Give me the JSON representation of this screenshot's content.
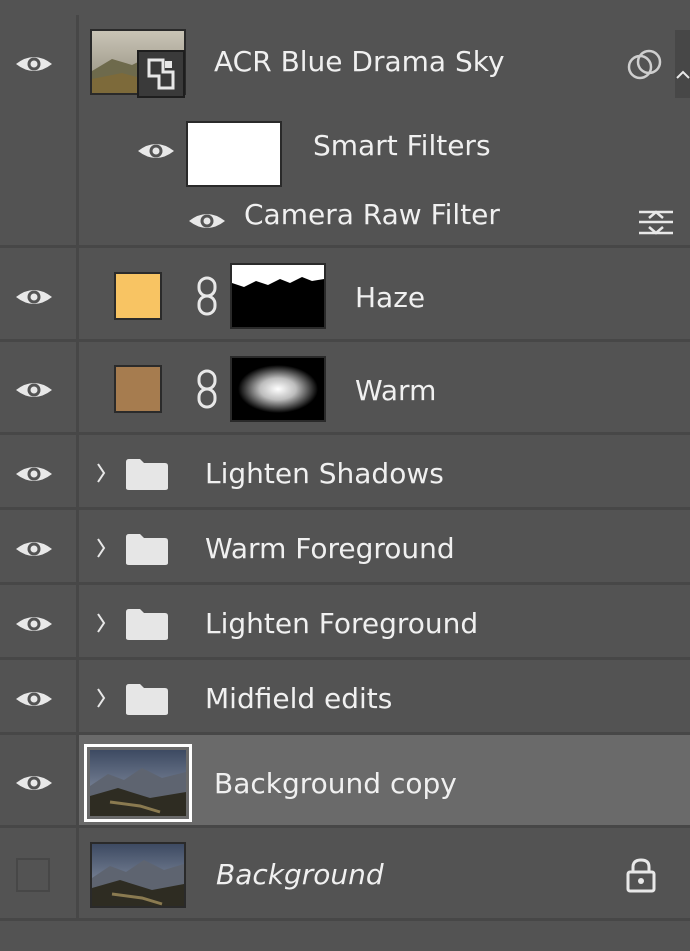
{
  "layers": {
    "acr": {
      "name": "ACR Blue Drama Sky"
    },
    "smart_filters": {
      "name": "Smart Filters"
    },
    "camera_raw": {
      "name": "Camera Raw Filter"
    },
    "haze": {
      "name": "Haze",
      "fill_color": "#f8c463"
    },
    "warm": {
      "name": "Warm",
      "fill_color": "#a67c4f"
    },
    "lighten_shadows": {
      "name": "Lighten Shadows"
    },
    "warm_foreground": {
      "name": "Warm Foreground"
    },
    "lighten_foreground": {
      "name": "Lighten Foreground"
    },
    "midfield": {
      "name": "Midfield edits"
    },
    "bg_copy": {
      "name": "Background copy"
    },
    "background": {
      "name": "Background"
    }
  },
  "colors": {
    "panel": "#535353",
    "divider": "#474747",
    "selected": "#6a6a6a",
    "text": "#f0f0f0"
  }
}
